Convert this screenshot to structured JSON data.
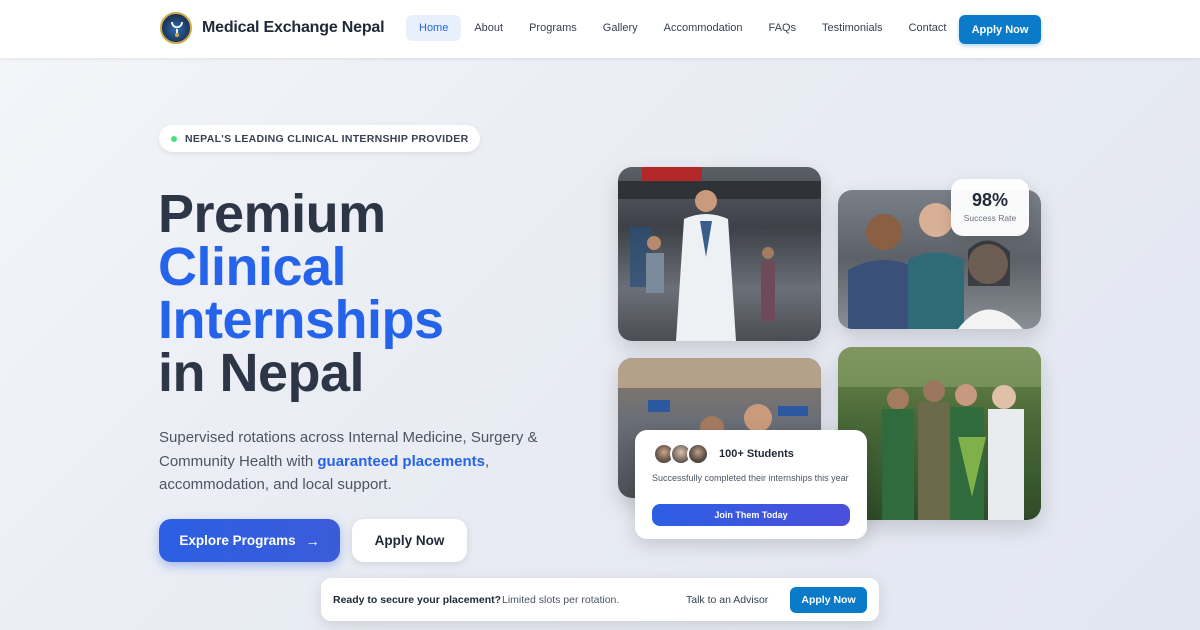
{
  "brand": {
    "name": "Medical Exchange Nepal"
  },
  "nav": {
    "items": [
      {
        "label": "Home",
        "active": true
      },
      {
        "label": "About"
      },
      {
        "label": "Programs"
      },
      {
        "label": "Gallery"
      },
      {
        "label": "Accommodation"
      },
      {
        "label": "FAQs"
      },
      {
        "label": "Testimonials"
      },
      {
        "label": "Contact"
      }
    ],
    "apply_label": "Apply Now"
  },
  "hero": {
    "badge": "NEPAL'S LEADING CLINICAL INTERNSHIP PROVIDER",
    "headline_line1": "Premium",
    "headline_line2": "Clinical",
    "headline_line3": "Internships",
    "headline_line4": "in Nepal",
    "sub_before": "Supervised rotations across Internal Medicine, Surgery & Community Health with ",
    "sub_highlight": "guaranteed placements",
    "sub_after": ", accommodation, and local support.",
    "primary_cta": "Explore Programs",
    "primary_cta_icon": "arrow-right-icon",
    "secondary_cta": "Apply Now"
  },
  "stats": {
    "value": "98%",
    "label": "Success Rate"
  },
  "students_card": {
    "title": "100+ Students",
    "description": "Successfully completed their internships this year",
    "button": "Join Them Today"
  },
  "cta_bar": {
    "question": "Ready to secure your placement?",
    "note": "Limited slots per rotation.",
    "advisor": "Talk to an Advisor",
    "apply": "Apply Now"
  },
  "colors": {
    "accent_blue": "#2563eb",
    "cta_blue": "#0b7bc9",
    "heading_dark": "#2d3646",
    "status_green": "#4ade80"
  }
}
